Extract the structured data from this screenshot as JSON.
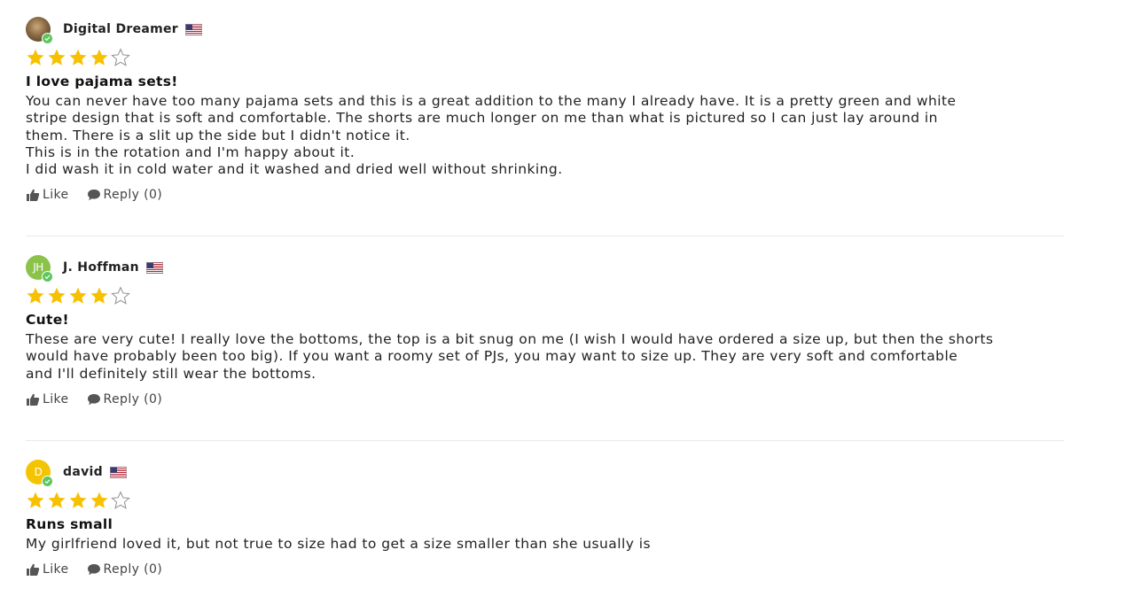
{
  "colors": {
    "star": "#f7c000",
    "verified": "#5ec65e"
  },
  "reviews": [
    {
      "author": "Digital Dreamer",
      "avatar_initials": "",
      "rating": 4,
      "title": "I love pajama sets!",
      "body_lines": [
        "You can never have too many pajama sets and this is a great addition to the many I already have. It is a pretty green and white",
        "stripe design that is soft and comfortable. The shorts are much longer on me than what is pictured so I can just lay around in",
        "them. There is a slit up the side but I didn't notice it.",
        "This is in the rotation and I'm happy about it.",
        "I did wash it in cold water and it washed and dried well without shrinking."
      ],
      "like_label": "Like",
      "reply_label": "Reply (0)"
    },
    {
      "author": "J. Hoffman",
      "avatar_initials": "JH",
      "rating": 4,
      "title": "Cute!",
      "body_lines": [
        "These are very cute! I really love the bottoms, the top is a bit snug on me (I wish I would have ordered a size up, but then the shorts",
        "would have probably been too big). If you want a roomy set of PJs, you may want to size up. They are very soft and comfortable",
        "and I'll definitely still wear the bottoms."
      ],
      "like_label": "Like",
      "reply_label": "Reply (0)"
    },
    {
      "author": "david",
      "avatar_initials": "D",
      "rating": 4,
      "title": "Runs small",
      "body_lines": [
        "My girlfriend loved it, but not true to size had to get a size smaller than she usually is"
      ],
      "like_label": "Like",
      "reply_label": "Reply (0)"
    }
  ]
}
